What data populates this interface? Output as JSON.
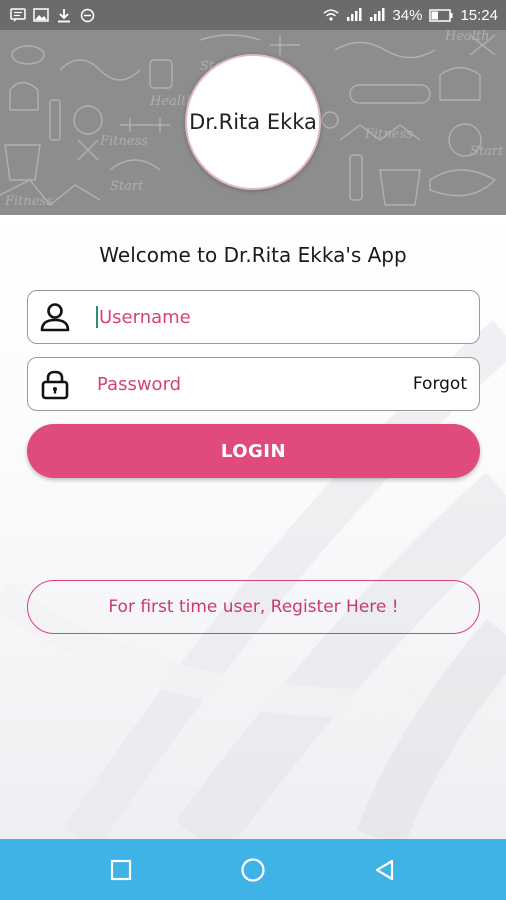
{
  "status_bar": {
    "battery_percent": "34%",
    "time": "15:24",
    "icons": [
      "message-icon",
      "image-icon",
      "download-icon",
      "minus-circle-icon",
      "wifi-icon",
      "signal-icon",
      "signal-icon",
      "battery-icon"
    ]
  },
  "header": {
    "logo_text": "Dr.Rita Ekka",
    "banner_color": "#8d8d8d"
  },
  "welcome": "Welcome to Dr.Rita Ekka's App",
  "login_form": {
    "username_placeholder": "Username",
    "password_placeholder": "Password",
    "forgot_label": "Forgot",
    "login_label": "LOGIN"
  },
  "register_label": "For first time user, Register Here !",
  "colors": {
    "accent": "#e04a7e",
    "nav_bar": "#3fb3e6"
  },
  "nav_bar": {
    "icons": [
      "recent-apps-icon",
      "home-icon",
      "back-icon"
    ]
  }
}
